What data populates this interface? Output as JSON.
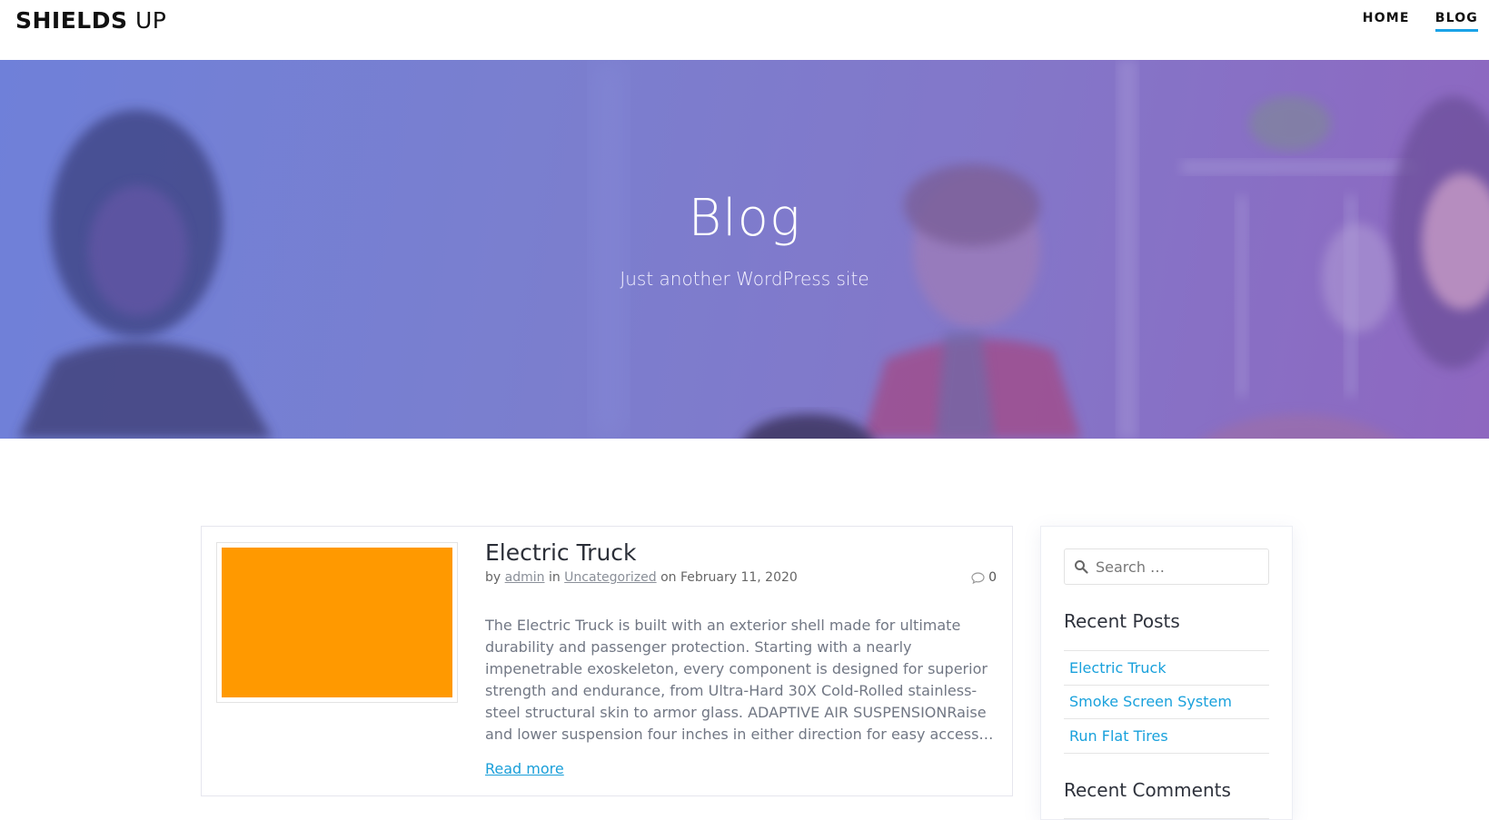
{
  "brand": {
    "bold": "SHIELDS",
    "light": "UP"
  },
  "nav": {
    "home": "HOME",
    "blog": "BLOG"
  },
  "hero": {
    "title": "Blog",
    "subtitle": "Just another WordPress site"
  },
  "post": {
    "title": "Electric Truck",
    "meta_by": "by",
    "author": "admin",
    "meta_in": "in",
    "category": "Uncategorized",
    "meta_on": "on",
    "date": "February 11, 2020",
    "comment_count": "0",
    "excerpt": "The Electric Truck is built with an exterior shell made for ultimate durability and passenger protection. Starting with a nearly impenetrable exoskeleton, every component is designed for superior strength and endurance, from Ultra-Hard 30X Cold-Rolled stainless-steel structural skin to armor glass. ADAPTIVE AIR SUSPENSIONRaise and lower suspension four inches in either direction for easy access…",
    "read_more": "Read more",
    "thumbnail_color": "#ff9900"
  },
  "sidebar": {
    "search_placeholder": "Search …",
    "recent_posts_title": "Recent Posts",
    "recent_posts": [
      "Electric Truck",
      "Smoke Screen System",
      "Run Flat Tires"
    ],
    "recent_comments_title": "Recent Comments"
  },
  "colors": {
    "accent": "#1aa3e8",
    "link": "#19a1dc",
    "hero_gradient_start": "#6f80d9",
    "hero_gradient_end": "#8e67c0"
  }
}
